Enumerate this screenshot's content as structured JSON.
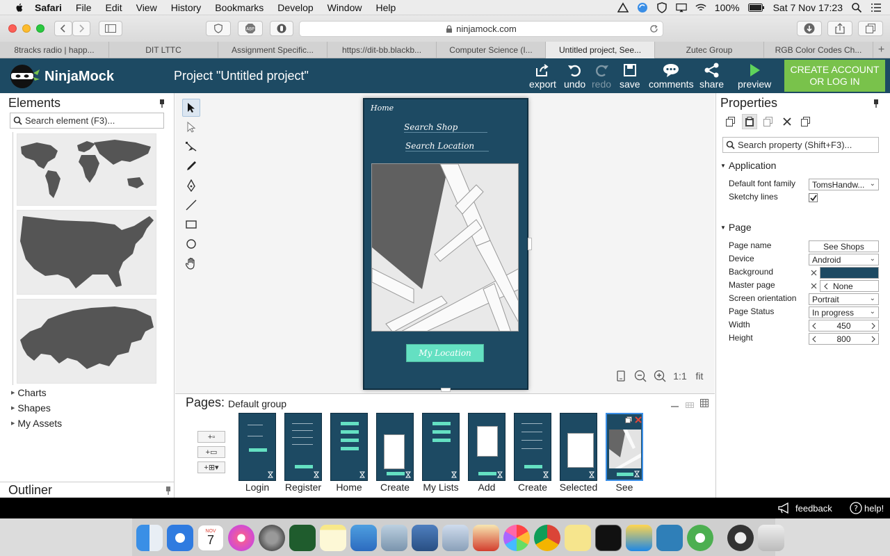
{
  "menubar": {
    "items": [
      "Safari",
      "File",
      "Edit",
      "View",
      "History",
      "Bookmarks",
      "Develop",
      "Window",
      "Help"
    ],
    "battery": "100%",
    "datetime": "Sat 7 Nov  17:23"
  },
  "browser": {
    "url": "ninjamock.com",
    "tabs": [
      {
        "label": "8tracks radio | happ..."
      },
      {
        "label": "DIT LTTC"
      },
      {
        "label": "Assignment Specific..."
      },
      {
        "label": "https://dit-bb.blackb..."
      },
      {
        "label": "Computer Science (I..."
      },
      {
        "label": "Untitled project, See...",
        "active": true
      },
      {
        "label": "Zutec Group"
      },
      {
        "label": "RGB Color Codes Ch..."
      }
    ]
  },
  "app": {
    "logo": "NinjaMock",
    "project_title": "Project \"Untitled project\"",
    "actions": {
      "export": "export",
      "undo": "undo",
      "redo": "redo",
      "save": "save",
      "comments": "comments",
      "share": "share",
      "preview": "preview"
    },
    "create_account": "CREATE ACCOUNT OR LOG IN",
    "colors": {
      "header": "#1d4a63",
      "accent_green": "#79c24b",
      "button_mint": "#64e0c2"
    }
  },
  "elements_panel": {
    "title": "Elements",
    "search_placeholder": "Search element (F3)...",
    "tree": [
      "Charts",
      "Shapes",
      "My Assets"
    ]
  },
  "outliner": {
    "title": "Outliner"
  },
  "mockup": {
    "title": "Home",
    "search_shop": "Search Shop",
    "search_location": "Search Location",
    "button": "My Location"
  },
  "zoom": {
    "one_to_one": "1:1",
    "fit": "fit"
  },
  "pages": {
    "title": "Pages:",
    "group": "Default group",
    "list": [
      "Login",
      "Register",
      "Home",
      "Create",
      "My Lists",
      "Add",
      "Create",
      "Selected",
      "See"
    ]
  },
  "properties": {
    "title": "Properties",
    "search_placeholder": "Search property (Shift+F3)...",
    "application": {
      "section": "Application",
      "font_label": "Default font family",
      "font_value": "TomsHandw...",
      "sketchy_label": "Sketchy lines",
      "sketchy_checked": true
    },
    "page": {
      "section": "Page",
      "name_label": "Page name",
      "name_value": "See Shops",
      "device_label": "Device",
      "device_value": "Android",
      "bg_label": "Background",
      "bg_color": "#1d4a63",
      "master_label": "Master page",
      "master_value": "None",
      "orient_label": "Screen orientation",
      "orient_value": "Portrait",
      "status_label": "Page Status",
      "status_value": "In progress",
      "width_label": "Width",
      "width_value": "450",
      "height_label": "Height",
      "height_value": "800"
    }
  },
  "footer": {
    "feedback": "feedback",
    "help": "help!"
  },
  "dock": {
    "calendar_month": "NOV",
    "calendar_day": "7"
  }
}
